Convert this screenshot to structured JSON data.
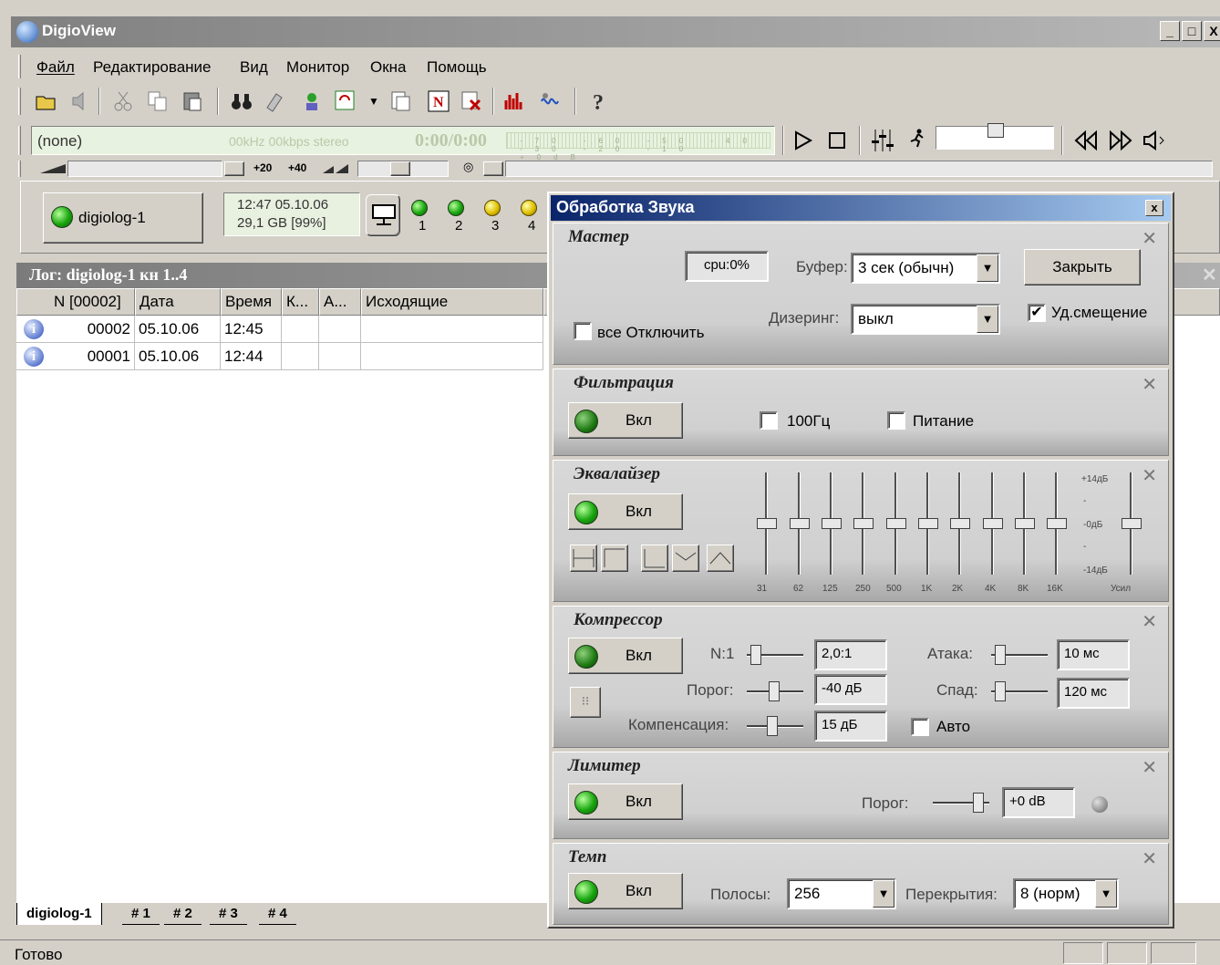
{
  "window": {
    "title": "DigioView",
    "min": "_",
    "max": "□",
    "close": "X"
  },
  "menu": [
    "Файл",
    "Редактирование",
    "Вид",
    "Монитор",
    "Окна",
    "Помощь"
  ],
  "player": {
    "track": "(none)",
    "info": "00kHz 00kbps stereo",
    "time": "0:00/0:00",
    "meter_ticks": "-70 -60 -50 -40 -30 -20 -10 +0dB"
  },
  "slider_bar": {
    "plus20": "+20",
    "plus40": "+40"
  },
  "device": {
    "name": "digiolog-1",
    "time": "12:47  05.10.06",
    "disk": "29,1 GB   [99%]",
    "channels": [
      "1",
      "2",
      "3",
      "4"
    ]
  },
  "log": {
    "title": "Лог: digiolog-1  кн 1..4",
    "columns": [
      "N [00002]",
      "Дата",
      "Время",
      "К...",
      "А...",
      "Исходящие"
    ],
    "rows": [
      {
        "n": "00002",
        "date": "05.10.06",
        "time": "12:45"
      },
      {
        "n": "00001",
        "date": "05.10.06",
        "time": "12:44"
      }
    ],
    "info_glyph": "i"
  },
  "tabs": [
    "digiolog-1",
    "# 1",
    "# 2",
    "# 3",
    "# 4"
  ],
  "status": "Готово",
  "dialog": {
    "title": "Обработка Звука",
    "close_glyph": "x",
    "section_close": "✕",
    "master": {
      "header": "Мастер",
      "cpu": "cpu:0%",
      "buffer_label": "Буфер:",
      "buffer_value": "3 сек (обычн)",
      "close_button": "Закрыть",
      "dither_label": "Дизеринг:",
      "dither_value": "выкл",
      "all_off": "все Отключить",
      "dc_offset": "Уд.смещение",
      "dc_offset_checked": true
    },
    "filter": {
      "header": "Фильтрация",
      "on": "Вкл",
      "hz100": "100Гц",
      "power": "Питание"
    },
    "eq": {
      "header": "Эквалайзер",
      "on": "Вкл",
      "bands": [
        "31",
        "62",
        "125",
        "250",
        "500",
        "1K",
        "2K",
        "4K",
        "8K",
        "16K",
        "Усил"
      ],
      "scale_top": "+14дБ",
      "scale_mid": "-0дБ",
      "scale_bot": "-14дБ",
      "gain_dot": "-"
    },
    "comp": {
      "header": "Компрессор",
      "on": "Вкл",
      "ratio_label": "N:1",
      "ratio": "2,0:1",
      "threshold_label": "Порог:",
      "threshold": "-40 дБ",
      "makeup_label": "Компенсация:",
      "makeup": "15 дБ",
      "attack_label": "Атака:",
      "attack": "10 мс",
      "release_label": "Спад:",
      "release": "120 мс",
      "auto": "Авто"
    },
    "limiter": {
      "header": "Лимитер",
      "on": "Вкл",
      "threshold_label": "Порог:",
      "threshold": "+0 dB"
    },
    "tempo": {
      "header": "Темп",
      "on": "Вкл",
      "bands_label": "Полосы:",
      "bands": "256",
      "overlap_label": "Перекрытия:",
      "overlap": "8 (норм)"
    }
  }
}
